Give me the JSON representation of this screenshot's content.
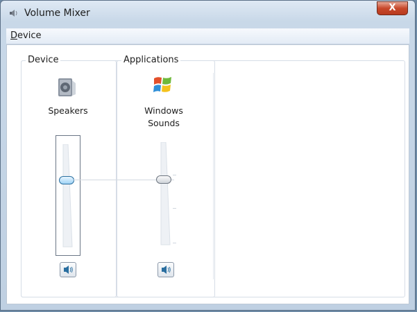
{
  "window": {
    "title": "Volume Mixer",
    "close_label": "X"
  },
  "menu": {
    "items": [
      {
        "accel": "D",
        "rest": "evice"
      }
    ]
  },
  "device_group": {
    "label": "Device",
    "channel": {
      "name": "Speakers",
      "icon": "speaker-icon",
      "volume_percent": 68,
      "muted": false
    }
  },
  "applications_group": {
    "label": "Applications",
    "channels": [
      {
        "name_line1": "Windows",
        "name_line2": "Sounds",
        "icon": "windows-logo-icon",
        "volume_percent": 68,
        "muted": false
      }
    ]
  },
  "colors": {
    "accent": "#2a6fa0",
    "close": "#c7482b",
    "frame": "#6d8aa6"
  }
}
